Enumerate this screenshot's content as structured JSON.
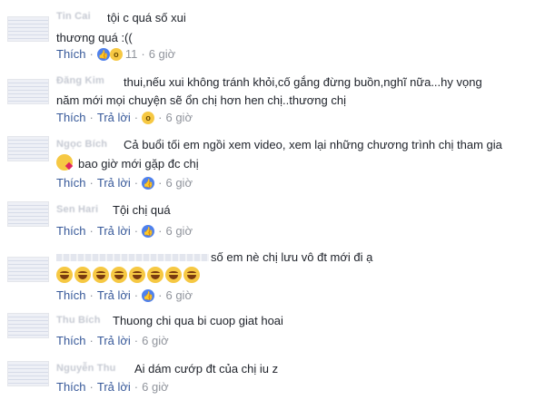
{
  "comments": [
    {
      "author": "Tin Cai",
      "lines": [
        "tội c quá số xui",
        "thương quá :(("
      ],
      "reaction_count": "11",
      "like_label": "Thích",
      "time": "6 giờ"
    },
    {
      "author": "Đăng Kim",
      "lines": [
        "thui,nếu xui không tránh khỏi,cố gắng đừng buồn,nghĩ nữa...hy vọng",
        "năm mới mọi chuyện sẽ ổn chị hơn hen chị..thương chị"
      ],
      "like_label": "Thích",
      "reply_label": "Trả lời",
      "time": "6 giờ"
    },
    {
      "author": "Ngọc Bích",
      "lines": [
        "Cả buổi tối em ngồi xem video, xem lại những chương trình chị tham gia",
        "bao giờ mới gặp đc chị"
      ],
      "like_label": "Thích",
      "reply_label": "Trả lời",
      "time": "6 giờ"
    },
    {
      "author": "Sen Hari",
      "lines": [
        "Tội chị quá"
      ],
      "like_label": "Thích",
      "reply_label": "Trả lời",
      "time": "6 giờ"
    },
    {
      "author": "",
      "lines": [
        "số em nè chị lưu vô đt mới đi ạ"
      ],
      "like_label": "Thích",
      "reply_label": "Trả lời",
      "time": "6 giờ"
    },
    {
      "author": "Thu Bích",
      "lines": [
        "Thuong chi qua bi cuop giat hoai"
      ],
      "like_label": "Thích",
      "reply_label": "Trả lời",
      "time": "6 giờ"
    },
    {
      "author": "Nguyễn Thu",
      "lines": [
        "Ai dám cướp đt của chị iu z"
      ],
      "like_label": "Thích",
      "reply_label": "Trả lời",
      "time": "6 giờ"
    }
  ],
  "separator": "·",
  "colors": {
    "link": "#365899",
    "meta": "#90949c",
    "text": "#1d2129",
    "like": "#4f81ec",
    "wow": "#f6c843"
  }
}
